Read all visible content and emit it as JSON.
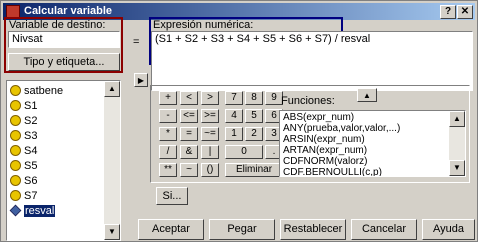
{
  "window": {
    "title": "Calcular variable"
  },
  "target_variable": {
    "label": "Variable de destino:",
    "value": "Nivsat",
    "type_label_button": "Tipo y etiqueta..."
  },
  "equals_sign": "=",
  "expression": {
    "label": "Expresión numérica:",
    "value": "(S1 + S2 + S3 + S4 + S5 + S6 + S7) / resval"
  },
  "variables": [
    {
      "name": "satbene",
      "kind": "scale"
    },
    {
      "name": "S1",
      "kind": "scale"
    },
    {
      "name": "S2",
      "kind": "scale"
    },
    {
      "name": "S3",
      "kind": "scale"
    },
    {
      "name": "S4",
      "kind": "scale"
    },
    {
      "name": "S5",
      "kind": "scale"
    },
    {
      "name": "S6",
      "kind": "scale"
    },
    {
      "name": "S7",
      "kind": "scale"
    },
    {
      "name": "resval",
      "kind": "numeric",
      "selected": true
    }
  ],
  "keypad": {
    "row1": [
      "+",
      "<",
      ">",
      "7",
      "8",
      "9"
    ],
    "row2": [
      "-",
      "<=",
      ">=",
      "4",
      "5",
      "6"
    ],
    "row3": [
      "*",
      "=",
      "~=",
      "1",
      "2",
      "3"
    ],
    "row4": [
      "/",
      "&",
      "|",
      "0",
      "."
    ],
    "row5": [
      "**",
      "~",
      "()"
    ],
    "delete": "Eliminar"
  },
  "functions": {
    "label": "Funciones:",
    "items": [
      "ABS(expr_num)",
      "ANY(prueba,valor,valor,...)",
      "ARSIN(expr_num)",
      "ARTAN(expr_num)",
      "CDFNORM(valorz)",
      "CDF.BERNOULLI(c,p)"
    ]
  },
  "if_button": "Si...",
  "buttons": {
    "ok": "Aceptar",
    "paste": "Pegar",
    "reset": "Restablecer",
    "cancel": "Cancelar",
    "help": "Ayuda"
  }
}
